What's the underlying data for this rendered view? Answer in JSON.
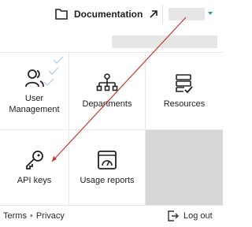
{
  "header": {
    "documentation_label": "Documentation"
  },
  "tiles": [
    {
      "label": "User Management",
      "icon": "users-icon"
    },
    {
      "label": "Departments",
      "icon": "org-chart-icon"
    },
    {
      "label": "Resources",
      "icon": "server-check-icon"
    },
    {
      "label": "API keys",
      "icon": "key-icon"
    },
    {
      "label": "Usage reports",
      "icon": "gauge-icon"
    }
  ],
  "footer": {
    "terms": "Terms",
    "separator": "•",
    "privacy": "Privacy",
    "logout": "Log out"
  },
  "colors": {
    "accent": "#1aa0a3",
    "annotation_arrow": "#c0392b"
  }
}
